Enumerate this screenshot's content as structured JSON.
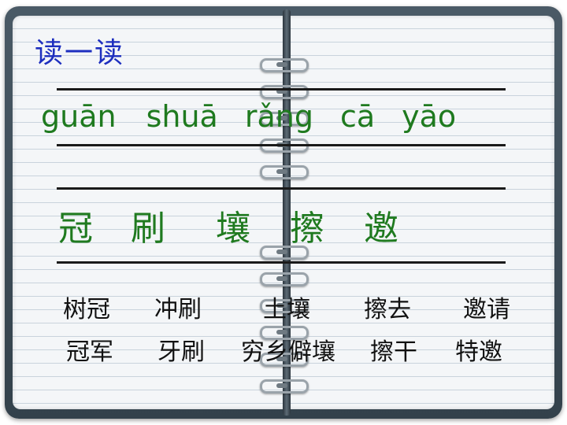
{
  "title": "读一读",
  "pinyin": [
    "guān",
    "shuā",
    "rǎng",
    "cā",
    "yāo"
  ],
  "characters": [
    "冠",
    "刷",
    "壤",
    "擦",
    "邀"
  ],
  "words_row1": [
    "树冠",
    "冲刷",
    "土壤",
    "擦去",
    "邀请"
  ],
  "words_row2": [
    "冠军",
    "牙刷",
    "穷乡僻壤",
    "擦干",
    "特邀"
  ],
  "colors": {
    "title": "#1e2fbf",
    "pinyin": "#1f7a1f",
    "characters": "#1f7a1f",
    "words": "#111111"
  }
}
